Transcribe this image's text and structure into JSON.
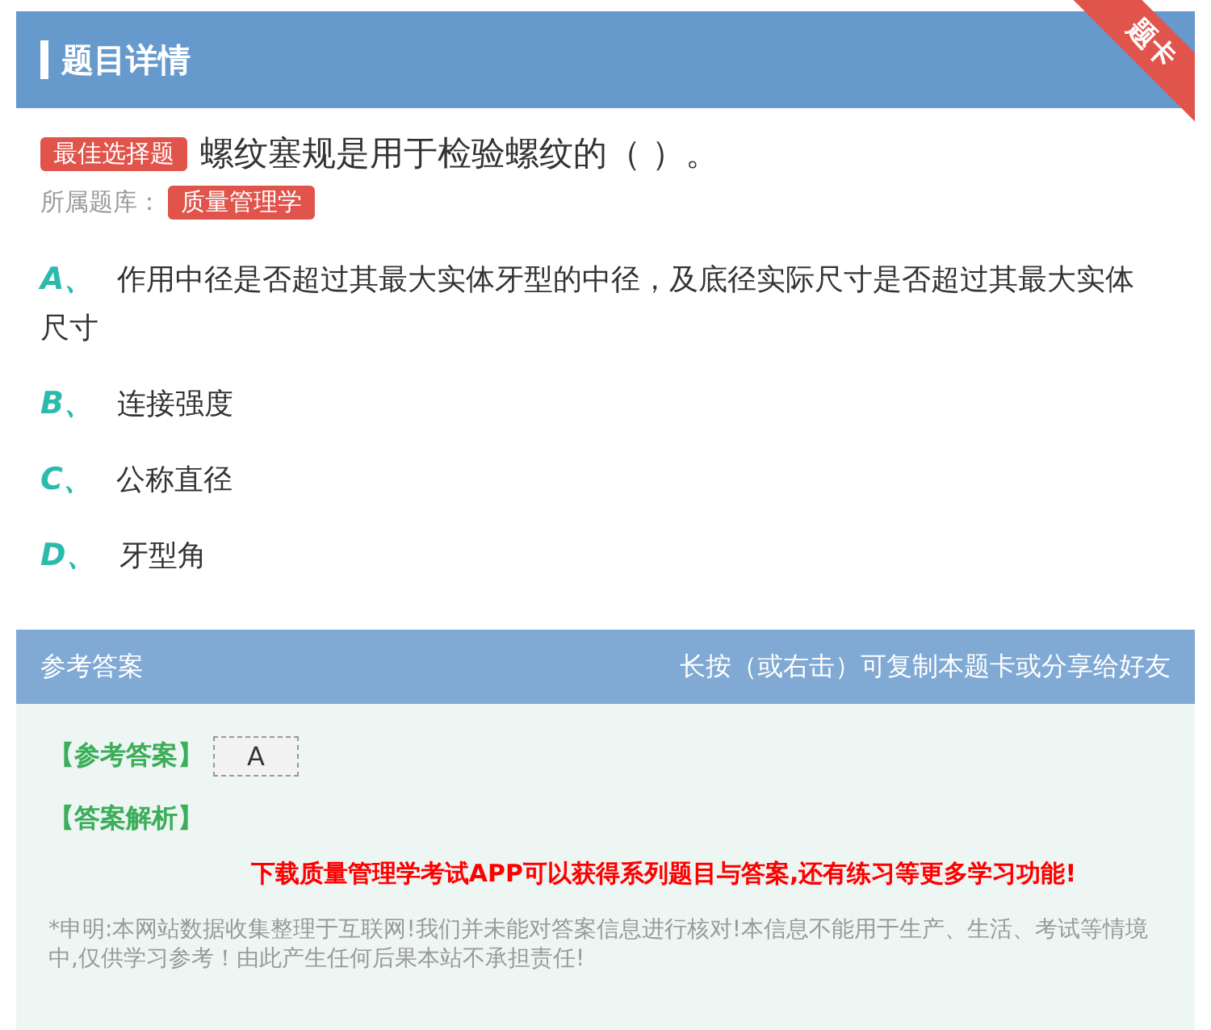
{
  "header": {
    "title": "题目详情",
    "ribbon": "题卡"
  },
  "question": {
    "type_tag": "最佳选择题",
    "text": "螺纹塞规是用于检验螺纹的（ ）。",
    "bank_label": "所属题库：",
    "bank_tag": "质量管理学"
  },
  "options": [
    {
      "letter": "A、",
      "text": "作用中径是否超过其最大实体牙型的中径，及底径实际尺寸是否超过其最大实体尺寸"
    },
    {
      "letter": "B、",
      "text": "连接强度"
    },
    {
      "letter": "C、",
      "text": "公称直径"
    },
    {
      "letter": "D、",
      "text": "牙型角"
    }
  ],
  "answer_panel": {
    "title": "参考答案",
    "hint": "长按（或右击）可复制本题卡或分享给好友",
    "answer_label": "【参考答案】",
    "answer": "A",
    "analysis_label": "【答案解析】",
    "promo": "下载质量管理学考试APP可以获得系列题目与答案,还有练习等更多学习功能!",
    "disclaimer": "*申明:本网站数据收集整理于互联网!我们并未能对答案信息进行核对!本信息不能用于生产、生活、考试等情境中,仅供学习参考！由此产生任何后果本站不承担责任!"
  }
}
